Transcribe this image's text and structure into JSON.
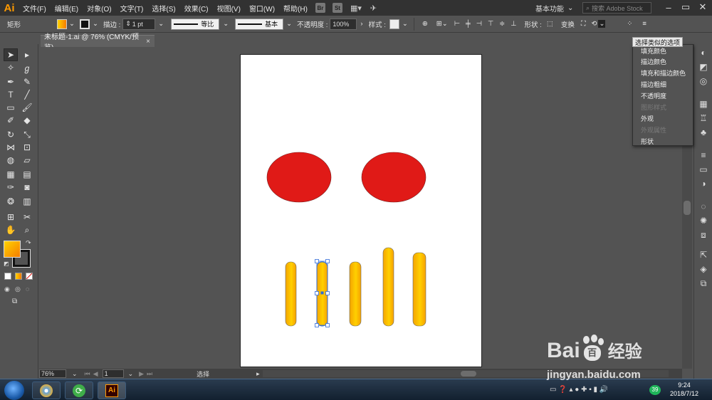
{
  "app": {
    "logo": "Ai"
  },
  "menu": [
    "文件(F)",
    "编辑(E)",
    "对象(O)",
    "文字(T)",
    "选择(S)",
    "效果(C)",
    "视图(V)",
    "窗口(W)",
    "帮助(H)"
  ],
  "menu_buttons": {
    "br": "Br",
    "st": "St"
  },
  "workspace": "基本功能",
  "search_placeholder": "搜索 Adobe Stock",
  "controlbar": {
    "selection_label": "矩形",
    "stroke_label": "描边 :",
    "stroke_value": "1 pt",
    "profile1": "等比",
    "profile2": "基本",
    "opacity_label": "不透明度 :",
    "opacity_value": "100%",
    "style_label": "样式 :",
    "shape_label": "形状 :",
    "transform_label": "变换"
  },
  "doc_tab": {
    "title": "未标题-1.ai @ 76% (CMYK/预览)",
    "close": "×"
  },
  "tooltip": "选择类似的选项",
  "dropdown_items": [
    {
      "label": "填充颜色",
      "disabled": false
    },
    {
      "label": "描边颜色",
      "disabled": false
    },
    {
      "label": "填充和描边颜色",
      "disabled": false
    },
    {
      "label": "描边粗细",
      "disabled": false
    },
    {
      "label": "不透明度",
      "disabled": false
    },
    {
      "label": "图形样式",
      "disabled": true
    },
    {
      "label": "外观",
      "disabled": false
    },
    {
      "label": "外观属性",
      "disabled": true
    },
    {
      "label": "形状",
      "disabled": false
    }
  ],
  "status": {
    "zoom": "76%",
    "page": "1",
    "tool": "选择"
  },
  "taskbar": {
    "time": "9:24",
    "date": "2018/7/12",
    "badge": "39",
    "ai_app": "Ai"
  },
  "watermark": {
    "brand": "Bai",
    "brand2": "百",
    "suffix": "经验",
    "url": "jingyan.baidu.com"
  },
  "colors": {
    "ellipse": "#e01a17",
    "bar_top": "#ffd000",
    "bar_side": "#f4a400",
    "fill_swatch_start": "#ffd300",
    "fill_swatch_end": "#f57c00",
    "selection": "#2f6bd8"
  }
}
